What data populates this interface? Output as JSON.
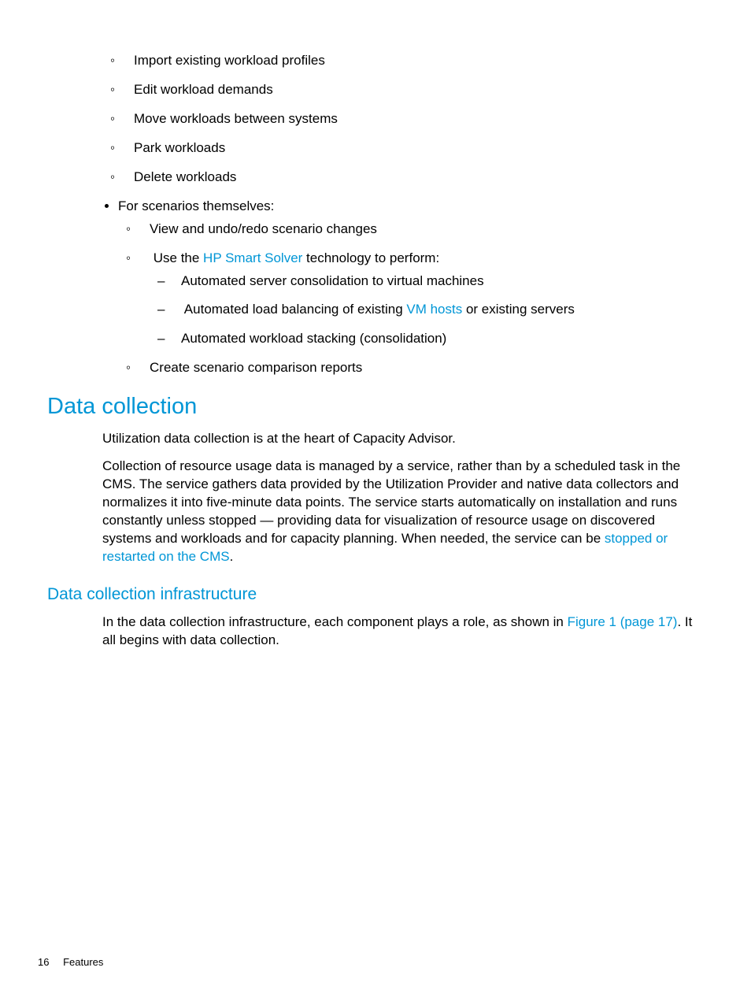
{
  "list": {
    "workloads": {
      "items": [
        "Import existing workload profiles",
        "Edit workload demands",
        "Move workloads between systems",
        "Park workloads",
        "Delete workloads"
      ]
    },
    "scenarios": {
      "label": "For scenarios themselves:",
      "sub": {
        "view": "View and undo/redo scenario changes",
        "use_prefix": "Use the ",
        "use_link": "HP Smart Solver",
        "use_suffix": " technology to perform:",
        "perform": {
          "a": "Automated server consolidation to virtual machines",
          "b_prefix": "Automated load balancing of existing ",
          "b_link": "VM hosts",
          "b_suffix": " or existing servers",
          "c": "Automated workload stacking (consolidation)"
        },
        "create": "Create scenario comparison reports"
      }
    }
  },
  "h1": "Data collection",
  "p1": "Utilization data collection is at the heart of Capacity Advisor.",
  "p2_a": "Collection of resource usage data is managed by a service, rather than by a scheduled task in the CMS. The service gathers data provided by the Utilization Provider and native data collectors and normalizes it into five-minute data points. The service starts automatically on installation and runs constantly unless stopped — providing data for visualization of resource usage on discovered systems and workloads and for capacity planning. When needed, the service can be ",
  "p2_link": "stopped or restarted on the CMS",
  "p2_b": ".",
  "h2": "Data collection infrastructure",
  "p3_a": "In the data collection infrastructure, each component plays a role, as shown in ",
  "p3_link": "Figure 1 (page 17)",
  "p3_b": ". It all begins with data collection.",
  "footer": {
    "page": "16",
    "section": "Features"
  }
}
